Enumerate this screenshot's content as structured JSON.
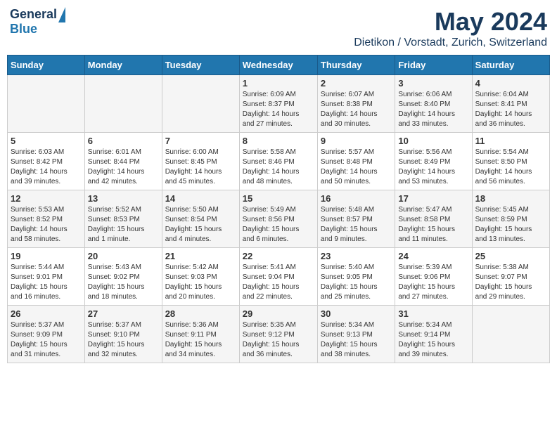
{
  "header": {
    "logo_line1": "General",
    "logo_line2": "Blue",
    "month": "May 2024",
    "location": "Dietikon / Vorstadt, Zurich, Switzerland"
  },
  "weekdays": [
    "Sunday",
    "Monday",
    "Tuesday",
    "Wednesday",
    "Thursday",
    "Friday",
    "Saturday"
  ],
  "weeks": [
    [
      {
        "day": "",
        "info": ""
      },
      {
        "day": "",
        "info": ""
      },
      {
        "day": "",
        "info": ""
      },
      {
        "day": "1",
        "info": "Sunrise: 6:09 AM\nSunset: 8:37 PM\nDaylight: 14 hours\nand 27 minutes."
      },
      {
        "day": "2",
        "info": "Sunrise: 6:07 AM\nSunset: 8:38 PM\nDaylight: 14 hours\nand 30 minutes."
      },
      {
        "day": "3",
        "info": "Sunrise: 6:06 AM\nSunset: 8:40 PM\nDaylight: 14 hours\nand 33 minutes."
      },
      {
        "day": "4",
        "info": "Sunrise: 6:04 AM\nSunset: 8:41 PM\nDaylight: 14 hours\nand 36 minutes."
      }
    ],
    [
      {
        "day": "5",
        "info": "Sunrise: 6:03 AM\nSunset: 8:42 PM\nDaylight: 14 hours\nand 39 minutes."
      },
      {
        "day": "6",
        "info": "Sunrise: 6:01 AM\nSunset: 8:44 PM\nDaylight: 14 hours\nand 42 minutes."
      },
      {
        "day": "7",
        "info": "Sunrise: 6:00 AM\nSunset: 8:45 PM\nDaylight: 14 hours\nand 45 minutes."
      },
      {
        "day": "8",
        "info": "Sunrise: 5:58 AM\nSunset: 8:46 PM\nDaylight: 14 hours\nand 48 minutes."
      },
      {
        "day": "9",
        "info": "Sunrise: 5:57 AM\nSunset: 8:48 PM\nDaylight: 14 hours\nand 50 minutes."
      },
      {
        "day": "10",
        "info": "Sunrise: 5:56 AM\nSunset: 8:49 PM\nDaylight: 14 hours\nand 53 minutes."
      },
      {
        "day": "11",
        "info": "Sunrise: 5:54 AM\nSunset: 8:50 PM\nDaylight: 14 hours\nand 56 minutes."
      }
    ],
    [
      {
        "day": "12",
        "info": "Sunrise: 5:53 AM\nSunset: 8:52 PM\nDaylight: 14 hours\nand 58 minutes."
      },
      {
        "day": "13",
        "info": "Sunrise: 5:52 AM\nSunset: 8:53 PM\nDaylight: 15 hours\nand 1 minute."
      },
      {
        "day": "14",
        "info": "Sunrise: 5:50 AM\nSunset: 8:54 PM\nDaylight: 15 hours\nand 4 minutes."
      },
      {
        "day": "15",
        "info": "Sunrise: 5:49 AM\nSunset: 8:56 PM\nDaylight: 15 hours\nand 6 minutes."
      },
      {
        "day": "16",
        "info": "Sunrise: 5:48 AM\nSunset: 8:57 PM\nDaylight: 15 hours\nand 9 minutes."
      },
      {
        "day": "17",
        "info": "Sunrise: 5:47 AM\nSunset: 8:58 PM\nDaylight: 15 hours\nand 11 minutes."
      },
      {
        "day": "18",
        "info": "Sunrise: 5:45 AM\nSunset: 8:59 PM\nDaylight: 15 hours\nand 13 minutes."
      }
    ],
    [
      {
        "day": "19",
        "info": "Sunrise: 5:44 AM\nSunset: 9:01 PM\nDaylight: 15 hours\nand 16 minutes."
      },
      {
        "day": "20",
        "info": "Sunrise: 5:43 AM\nSunset: 9:02 PM\nDaylight: 15 hours\nand 18 minutes."
      },
      {
        "day": "21",
        "info": "Sunrise: 5:42 AM\nSunset: 9:03 PM\nDaylight: 15 hours\nand 20 minutes."
      },
      {
        "day": "22",
        "info": "Sunrise: 5:41 AM\nSunset: 9:04 PM\nDaylight: 15 hours\nand 22 minutes."
      },
      {
        "day": "23",
        "info": "Sunrise: 5:40 AM\nSunset: 9:05 PM\nDaylight: 15 hours\nand 25 minutes."
      },
      {
        "day": "24",
        "info": "Sunrise: 5:39 AM\nSunset: 9:06 PM\nDaylight: 15 hours\nand 27 minutes."
      },
      {
        "day": "25",
        "info": "Sunrise: 5:38 AM\nSunset: 9:07 PM\nDaylight: 15 hours\nand 29 minutes."
      }
    ],
    [
      {
        "day": "26",
        "info": "Sunrise: 5:37 AM\nSunset: 9:09 PM\nDaylight: 15 hours\nand 31 minutes."
      },
      {
        "day": "27",
        "info": "Sunrise: 5:37 AM\nSunset: 9:10 PM\nDaylight: 15 hours\nand 32 minutes."
      },
      {
        "day": "28",
        "info": "Sunrise: 5:36 AM\nSunset: 9:11 PM\nDaylight: 15 hours\nand 34 minutes."
      },
      {
        "day": "29",
        "info": "Sunrise: 5:35 AM\nSunset: 9:12 PM\nDaylight: 15 hours\nand 36 minutes."
      },
      {
        "day": "30",
        "info": "Sunrise: 5:34 AM\nSunset: 9:13 PM\nDaylight: 15 hours\nand 38 minutes."
      },
      {
        "day": "31",
        "info": "Sunrise: 5:34 AM\nSunset: 9:14 PM\nDaylight: 15 hours\nand 39 minutes."
      },
      {
        "day": "",
        "info": ""
      }
    ]
  ]
}
